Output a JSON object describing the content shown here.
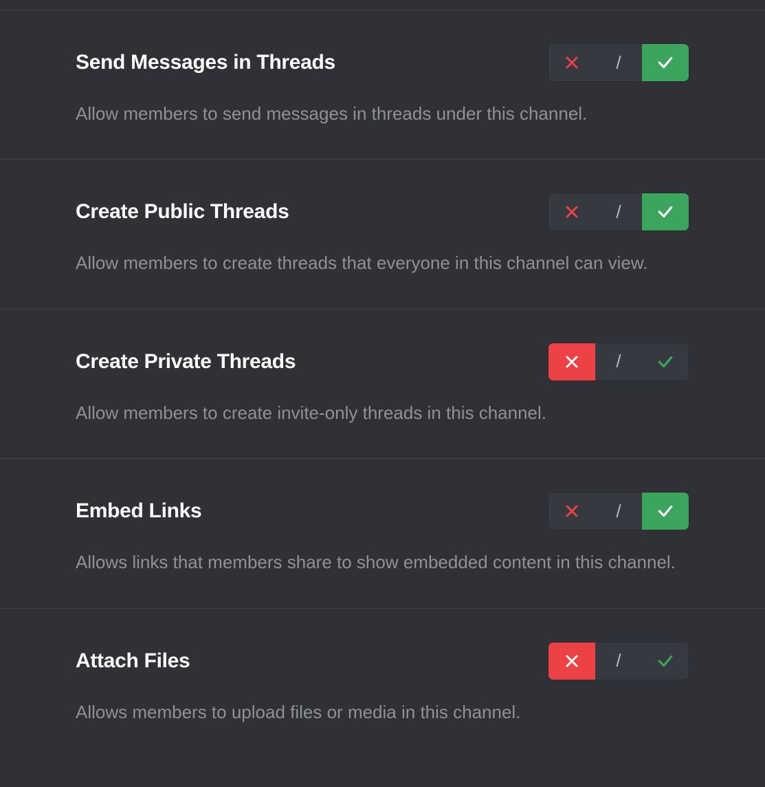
{
  "permissions": [
    {
      "title": "Send Messages in Threads",
      "description": "Allow members to send messages in threads under this channel.",
      "state": "allow"
    },
    {
      "title": "Create Public Threads",
      "description": "Allow members to create threads that everyone in this channel can view.",
      "state": "allow"
    },
    {
      "title": "Create Private Threads",
      "description": "Allow members to create invite-only threads in this channel.",
      "state": "deny"
    },
    {
      "title": "Embed Links",
      "description": "Allows links that members share to show embedded content in this channel.",
      "state": "allow"
    },
    {
      "title": "Attach Files",
      "description": "Allows members to upload files or media in this channel.",
      "state": "deny"
    }
  ],
  "neutral_glyph": "/"
}
